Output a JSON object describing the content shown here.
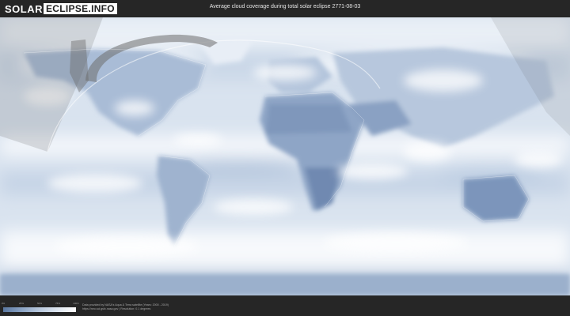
{
  "header": {
    "logo_part1": "SOLAR",
    "logo_part2": "ECLIPSE.INFO",
    "title": "Average cloud coverage during total solar eclipse 2771-08-03"
  },
  "legend": {
    "scale_ticks": [
      "0%",
      "25%",
      "50%",
      "75%",
      "100%"
    ]
  },
  "credits": {
    "line1": "Data provided by NASA's Aqua & Terra satellite (Years: 2000 - 2019)",
    "line2": "https://neo.sci.gsfc.nasa.gov | Resolution: 0.1 degrees"
  },
  "colors": {
    "background": "#232323",
    "clear_sky": "#5a77a0",
    "full_cloud": "#ffffff",
    "eclipse_path": "#7d7d7d"
  }
}
